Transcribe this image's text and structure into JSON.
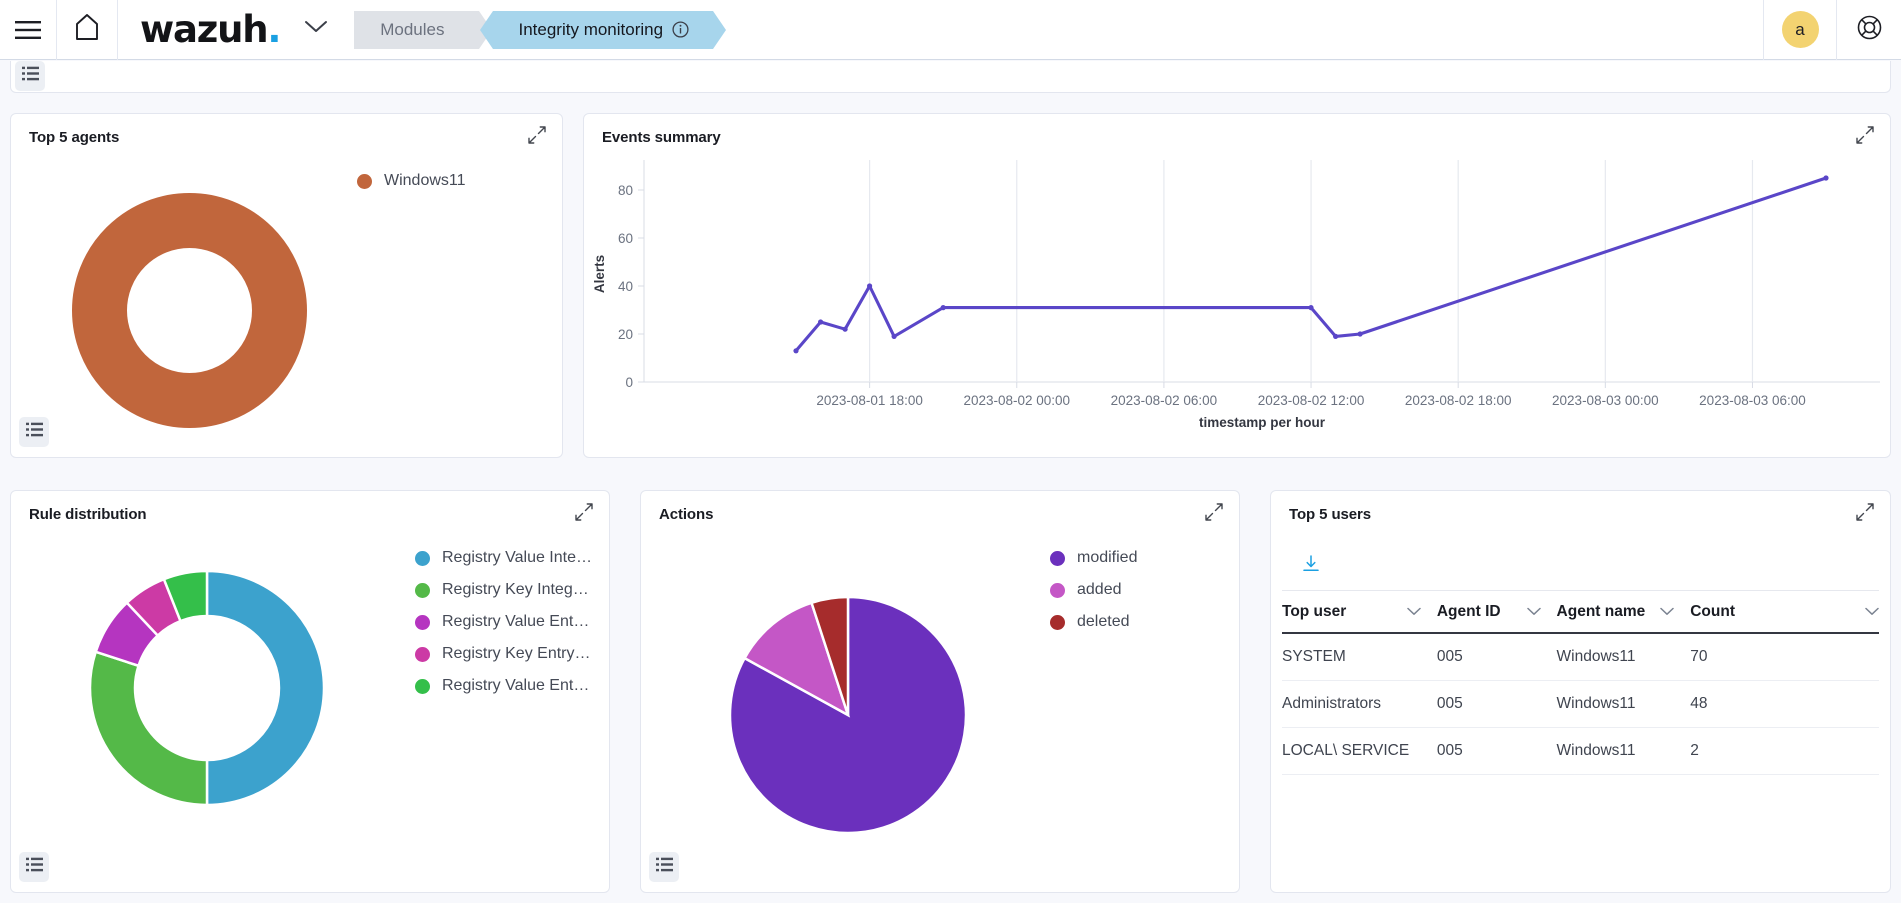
{
  "header": {
    "menu_icon": "hamburger-menu-icon",
    "home_icon": "home-icon",
    "logo_text": "wazuh",
    "logo_dot": ".",
    "chevron_icon": "chevron-down-icon",
    "breadcrumb_modules": "Modules",
    "breadcrumb_active": "Integrity monitoring",
    "info_icon": "info-circle-icon",
    "avatar_initial": "a",
    "help_icon": "help-lifebuoy-icon"
  },
  "panels": {
    "top_agents": {
      "title": "Top 5 agents",
      "expand_icon": "expand-icon",
      "legend_toggle_icon": "legend-list-icon"
    },
    "events_summary": {
      "title": "Events summary",
      "expand_icon": "expand-icon"
    },
    "rule_distribution": {
      "title": "Rule distribution",
      "expand_icon": "expand-icon",
      "legend_toggle_icon": "legend-list-icon"
    },
    "actions": {
      "title": "Actions",
      "expand_icon": "expand-icon",
      "legend_toggle_icon": "legend-list-icon"
    },
    "top_users": {
      "title": "Top 5 users",
      "expand_icon": "expand-icon",
      "download_icon": "download-icon"
    },
    "top_partial": {
      "legend_toggle_icon": "legend-list-icon"
    }
  },
  "chart_data": [
    {
      "id": "top_agents",
      "type": "pie",
      "title": "Top 5 agents",
      "donut": true,
      "labels": [
        "Windows11"
      ],
      "values": [
        100
      ],
      "colors": [
        "#c1663c"
      ],
      "legend_position": "right"
    },
    {
      "id": "events_summary",
      "type": "line",
      "title": "Events summary",
      "xlabel": "timestamp per hour",
      "ylabel": "Alerts",
      "ylim": [
        0,
        90
      ],
      "yticks": [
        0,
        20,
        40,
        60,
        80
      ],
      "xticks": [
        "2023-08-01 18:00",
        "2023-08-02 00:00",
        "2023-08-02 06:00",
        "2023-08-02 12:00",
        "2023-08-02 18:00",
        "2023-08-03 00:00",
        "2023-08-03 06:00"
      ],
      "grid": true,
      "series": [
        {
          "name": "Alerts",
          "color": "#5a46c8",
          "points": [
            {
              "x": "2023-08-01 15:00",
              "y": 13
            },
            {
              "x": "2023-08-01 16:00",
              "y": 25
            },
            {
              "x": "2023-08-01 17:00",
              "y": 22
            },
            {
              "x": "2023-08-01 18:00",
              "y": 40
            },
            {
              "x": "2023-08-01 19:00",
              "y": 19
            },
            {
              "x": "2023-08-01 21:00",
              "y": 31
            },
            {
              "x": "2023-08-02 12:00",
              "y": 31
            },
            {
              "x": "2023-08-02 13:00",
              "y": 19
            },
            {
              "x": "2023-08-02 14:00",
              "y": 20
            },
            {
              "x": "2023-08-03 09:00",
              "y": 85
            }
          ]
        }
      ]
    },
    {
      "id": "rule_distribution",
      "type": "pie",
      "title": "Rule distribution",
      "donut": true,
      "labels": [
        "Registry Value Integ...",
        "Registry Key Integrit...",
        "Registry Value Entry...",
        "Registry Key Entry ...",
        "Registry Value Entry..."
      ],
      "values": [
        50,
        30,
        8,
        6,
        6
      ],
      "colors": [
        "#3ca2cd",
        "#54b948",
        "#b535c0",
        "#cc3aa5",
        "#34bf4a"
      ],
      "legend_position": "right"
    },
    {
      "id": "actions",
      "type": "pie",
      "title": "Actions",
      "donut": false,
      "labels": [
        "modified",
        "added",
        "deleted"
      ],
      "values": [
        83,
        12,
        5
      ],
      "colors": [
        "#6b30bd",
        "#c457c6",
        "#a62c2c"
      ],
      "legend_position": "right"
    }
  ],
  "top_users_table": {
    "columns": [
      "Top user",
      "Agent ID",
      "Agent name",
      "Count"
    ],
    "sort_icon": "chevron-down-icon",
    "rows": [
      {
        "user": "SYSTEM",
        "agent_id": "005",
        "agent_name": "Windows11",
        "count": "70"
      },
      {
        "user": "Administrators",
        "agent_id": "005",
        "agent_name": "Windows11",
        "count": "48"
      },
      {
        "user": "LOCAL\\ SERVICE",
        "agent_id": "005",
        "agent_name": "Windows11",
        "count": "2"
      }
    ]
  },
  "colors": {
    "accent_blue": "#1ba0e2",
    "active_tab": "#a7d5ec",
    "avatar": "#f3d371",
    "background": "#f7f8fc"
  }
}
